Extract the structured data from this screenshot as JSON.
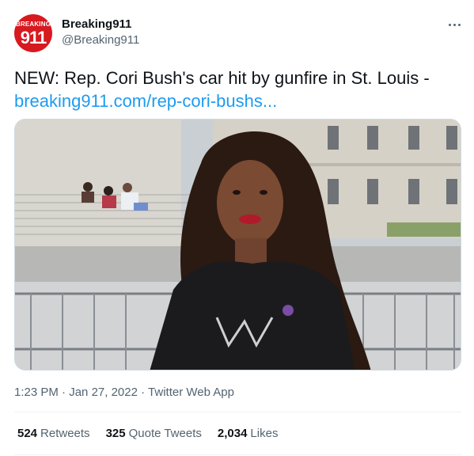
{
  "author": {
    "avatar_top_text": "BREAKING",
    "avatar_number": "911",
    "display_name": "Breaking911",
    "handle": "@Breaking911"
  },
  "tweet": {
    "text": "NEW: Rep. Cori Bush's car hit by gunfire in St. Louis -",
    "link_text": "breaking911.com/rep-cori-bushs..."
  },
  "media": {
    "icon": "photo"
  },
  "meta": {
    "time": "1:23 PM",
    "sep1": " · ",
    "date": "Jan 27, 2022",
    "sep2": " · ",
    "source": "Twitter Web App"
  },
  "stats": {
    "retweets_count": "524",
    "retweets_label": "Retweets",
    "quotes_count": "325",
    "quotes_label": "Quote Tweets",
    "likes_count": "2,034",
    "likes_label": "Likes"
  },
  "colors": {
    "brand_red": "#d71920",
    "link_blue": "#1d9bf0",
    "muted": "#536471"
  }
}
